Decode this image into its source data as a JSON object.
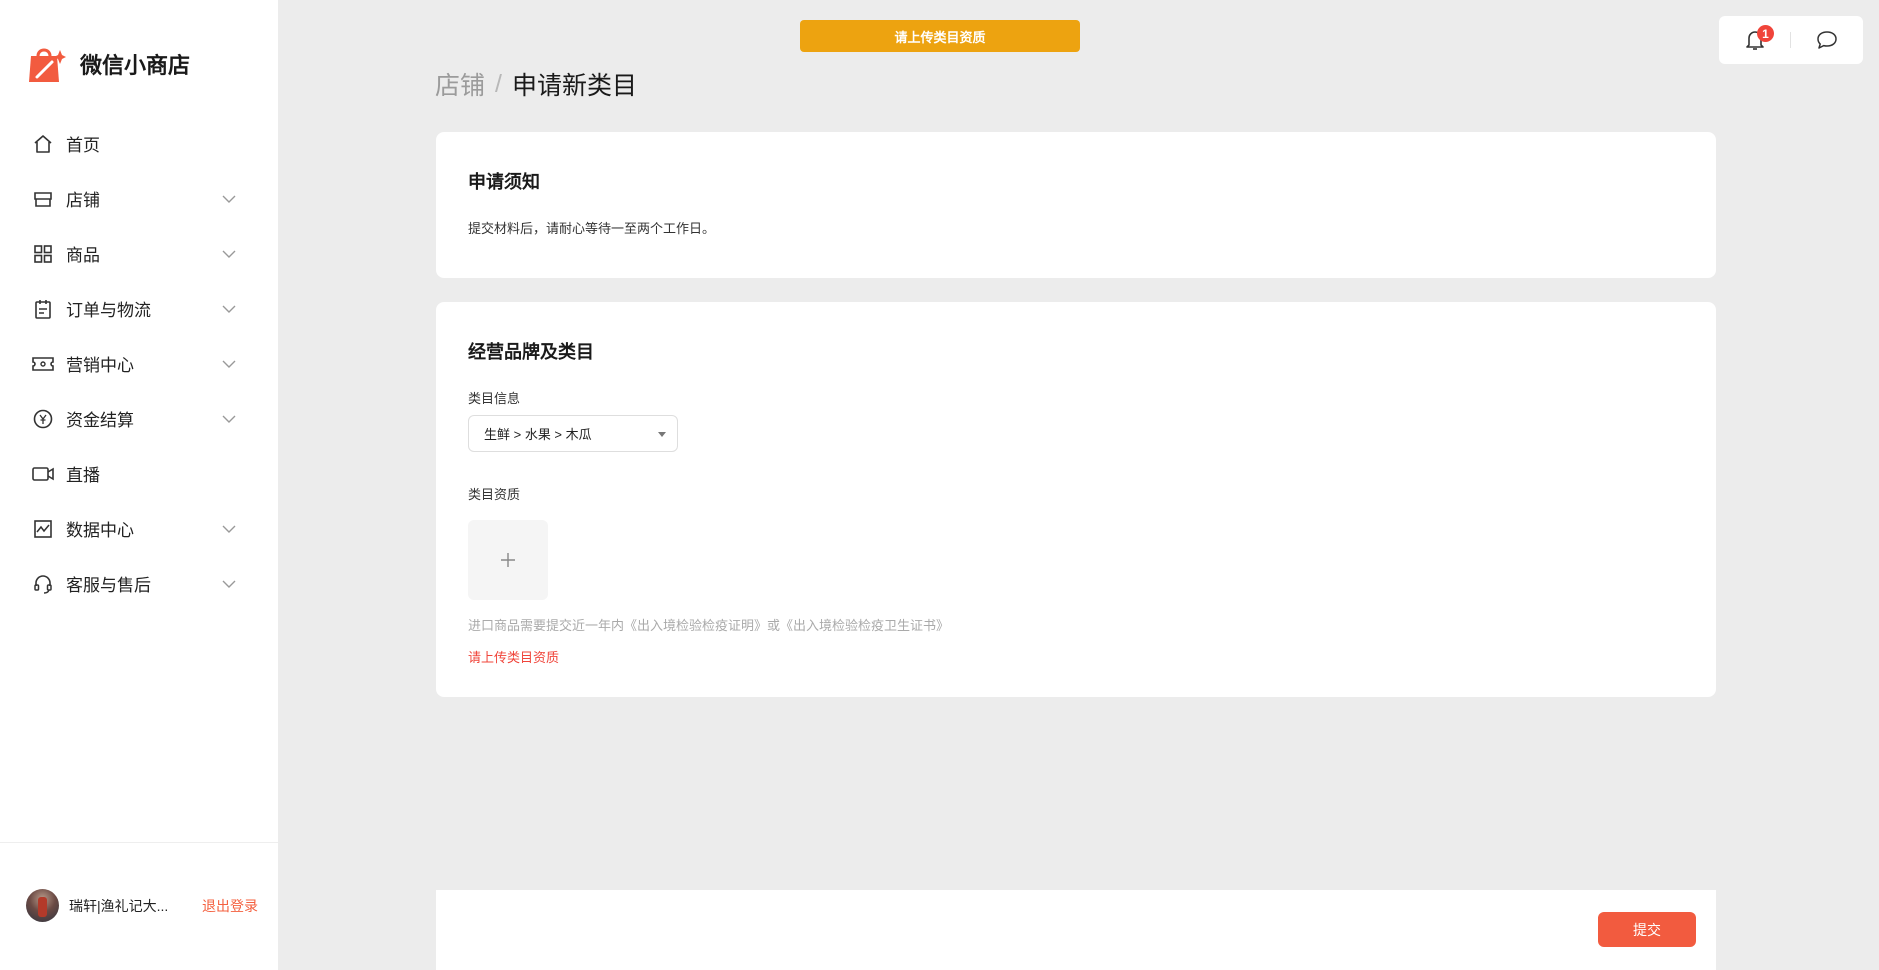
{
  "app": {
    "name": "微信小商店",
    "brand_color": "#f25b3f"
  },
  "sidebar": {
    "items": [
      {
        "label": "首页",
        "icon": "home-icon",
        "expandable": false
      },
      {
        "label": "店铺",
        "icon": "store-icon",
        "expandable": true
      },
      {
        "label": "商品",
        "icon": "grid-icon",
        "expandable": true
      },
      {
        "label": "订单与物流",
        "icon": "clipboard-icon",
        "expandable": true
      },
      {
        "label": "营销中心",
        "icon": "ticket-icon",
        "expandable": true
      },
      {
        "label": "资金结算",
        "icon": "yuan-coin-icon",
        "expandable": true
      },
      {
        "label": "直播",
        "icon": "video-camera-icon",
        "expandable": false
      },
      {
        "label": "数据中心",
        "icon": "chart-icon",
        "expandable": true
      },
      {
        "label": "客服与售后",
        "icon": "headset-icon",
        "expandable": true
      }
    ],
    "user": {
      "name": "瑞轩|渔礼记大...",
      "logout_label": "退出登录"
    }
  },
  "header": {
    "banner_text": "请上传类目资质",
    "banner_color": "#eda310",
    "notification_count": "1"
  },
  "breadcrumb": {
    "parent": "店铺",
    "separator": "/",
    "current": "申请新类目"
  },
  "notice_card": {
    "title": "申请须知",
    "text": "提交材料后，请耐心等待一至两个工作日。"
  },
  "category_card": {
    "title": "经营品牌及类目",
    "category_label": "类目信息",
    "category_value": "生鲜 > 水果 > 木瓜",
    "qualification_label": "类目资质",
    "hint": "进口商品需要提交近一年内《出入境检验检疫证明》或《出入境检验检疫卫生证书》",
    "error": "请上传类目资质"
  },
  "footer": {
    "submit_label": "提交"
  }
}
